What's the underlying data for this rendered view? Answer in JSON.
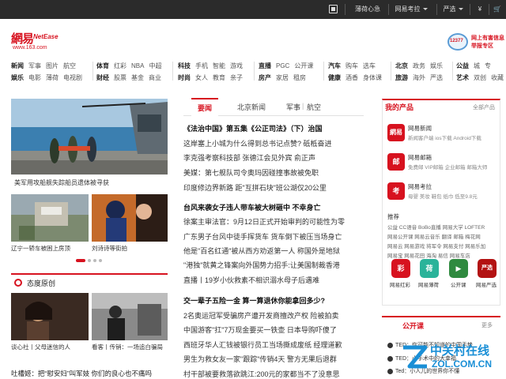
{
  "topbar": {
    "items": [
      "薄荷心急",
      "网易考拉",
      "严选"
    ]
  },
  "logo": {
    "cn": "網易",
    "en": "NetEase",
    "url": "www.163.com"
  },
  "report": {
    "badge": "12377",
    "line1": "网上有害信息",
    "line2": "举报专区"
  },
  "nav": {
    "g1": {
      "row1": [
        "新闻",
        "军事",
        "图片",
        "航空"
      ],
      "row2": [
        "娱乐",
        "电影",
        "薄荷",
        "电视剧"
      ]
    },
    "g2": {
      "row1": [
        "体育",
        "红彩",
        "NBA",
        "中超"
      ],
      "row2": [
        "财经",
        "股票",
        "基金",
        "商业"
      ]
    },
    "g3": {
      "row1": [
        "科技",
        "手机",
        "智能",
        "游戏"
      ],
      "row2": [
        "时尚",
        "女人",
        "教育",
        "亲子"
      ]
    },
    "g4": {
      "row1": [
        "直播",
        "PGC",
        "公开课"
      ],
      "row2": [
        "房产",
        "家居",
        "租房"
      ]
    },
    "g5": {
      "row1": [
        "汽车",
        "购车",
        "选车"
      ],
      "row2": [
        "健康",
        "酒香",
        "身体课"
      ]
    },
    "g6": {
      "row1": [
        "北京",
        "政务",
        "娱乐"
      ],
      "row2": [
        "旅游",
        "海外",
        "严选"
      ]
    },
    "g7": {
      "row1": [
        "公益",
        "城",
        "专"
      ],
      "row2": [
        "艺术",
        "双创",
        "收藏"
      ]
    }
  },
  "left": {
    "hero_caption": "美军用攻船舰失踪船员遗体被寻获",
    "thumb1_caption": "辽宁一轿车被困上房顶",
    "thumb2_caption": "刘诗诗等街拍",
    "section_title": "态度原创",
    "thumb3_caption": "谈心社丨父母迷信的人",
    "thumb4_caption": "看客丨传销：一场追白骗局",
    "headline": "吐槽姬：把“慰安妇”叫军妓 你们的良心也不痛吗"
  },
  "middle": {
    "tabs": [
      "要闻",
      "北京新闻",
      "军事",
      "航空"
    ],
    "news": [
      {
        "text": "《法治中国》第五集《公正司法》（下）治国",
        "bold": true
      },
      {
        "text": "这岸塞上小城为什么得到总书记点赞? 砥柢奋进",
        "bold": false
      },
      {
        "text": "李克强考察科技部 张德江会见外宾 俞正声",
        "bold": false
      },
      {
        "text": "美媒：第七舰队司令奥玛因碰撞事故被免职",
        "bold": false
      },
      {
        "text": "印度修边界新路 距\"互拼石块\"班公湖仅20公里",
        "bold": false
      },
      {
        "text": "台风来袭女子违人带车被大树砸中 不幸身亡",
        "bold": true
      },
      {
        "text": "徐案主审法官：9月12日正式开始审判的可能性为零",
        "bold": false
      },
      {
        "text": "广东男子台风中徒手挥货车 货车倒下被压当场身亡",
        "bold": false
      },
      {
        "text": "他是\"百名红通\"被从西方劝返第一人 称国外是地狱",
        "bold": false
      },
      {
        "text": "\"港独\"就黄之锋案向外国势力招手:让美国制裁香港",
        "bold": false
      },
      {
        "text": "直播丨19岁小伙救素不相识溺水母子后遇难",
        "bold": false
      },
      {
        "text": "交一辈子五险一金 算一算退休你能拿回多少?",
        "bold": true
      },
      {
        "text": "2名奥运冠军受骗房产遭开发商擅改产权 险被拍卖",
        "bold": false
      },
      {
        "text": "中国游客\"扛\"7万现金要买一铁壶 日本导购吓傻了",
        "bold": false
      },
      {
        "text": "西班牙华人汇钱被银行员工当场撕成废纸 经理道歉",
        "bold": false
      },
      {
        "text": "男生为救女友一家\"跟踪\"传销4天 警方无果后退群",
        "bold": false
      },
      {
        "text": "村干部被要救落欲跳江:200元的家都当不了没意思",
        "bold": false
      }
    ]
  },
  "right": {
    "title": "我的产品",
    "more": "全部产品",
    "products": [
      {
        "icon": "網易",
        "name": "网易新闻",
        "sub": "新闻客户端 ios下载 Android下载"
      },
      {
        "icon": "邮",
        "name": "网易邮箱",
        "sub": "免费邮 VIP邮箱 企业邮箱 邮箱大师"
      },
      {
        "icon": "考",
        "name": "网易考拉",
        "sub": "母婴 美妆 鞋包 纸巾 低至9.8元"
      }
    ],
    "rec_title": "推荐",
    "rec_lines": [
      "公益  CC语音  BoBo直播  网易大学  LOFTER",
      "网易公开课  网易云音乐  翻译  邮箱  梅花网",
      "网易云  网易游戏  将军令  网易支付  网易乐加",
      "网易宝  网易花田  海淘  易信  网易车店"
    ],
    "apps": [
      {
        "label": "网易红彩",
        "icon": "彩",
        "color": "#d7121f"
      },
      {
        "label": "网易薄荷",
        "icon": "荷",
        "color": "#2bb39a"
      },
      {
        "label": "公开课",
        "icon": "▶",
        "color": "#2f8a3f"
      },
      {
        "label": "网易严选",
        "icon": "严选",
        "color": "#b31212"
      }
    ],
    "open_title": "公开课",
    "open_more": "更多",
    "open_items": [
      "TED：你可能不知道的中国手势",
      "TED：小手术中的大幸福",
      "Ted：小人儿的世界你不懂"
    ]
  },
  "watermark": {
    "line1": "中关村在线",
    "line2": "ZOL.COM.CN"
  }
}
